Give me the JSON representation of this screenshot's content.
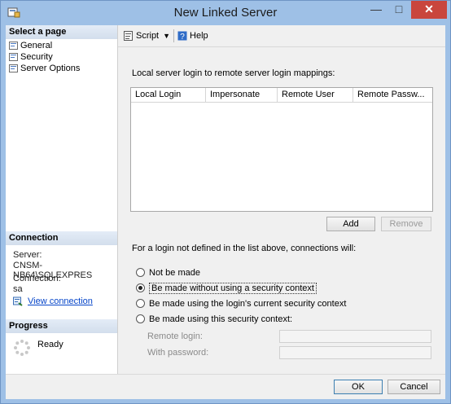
{
  "window": {
    "title": "New Linked Server",
    "minimize_glyph": "—",
    "maximize_glyph": "□",
    "close_glyph": "✕"
  },
  "left_pane": {
    "select_page_header": "Select a page",
    "pages": [
      {
        "label": "General"
      },
      {
        "label": "Security"
      },
      {
        "label": "Server Options"
      }
    ],
    "connection_header": "Connection",
    "server_label": "Server:",
    "server_value": "CNSM-NB64\\SQLEXPRES",
    "connection_label": "Connection:",
    "connection_value": "sa",
    "view_connection_link": "View connection",
    "progress_header": "Progress",
    "progress_status": "Ready"
  },
  "toolbar": {
    "script_label": "Script",
    "help_label": "Help"
  },
  "security": {
    "mappings_label": "Local server login to remote server login mappings:",
    "columns": [
      "Local Login",
      "Impersonate",
      "Remote User",
      "Remote Passw..."
    ],
    "add_button": "Add",
    "remove_button": "Remove",
    "not_defined_label": "For a login not defined in the list above, connections will:",
    "options": [
      {
        "label": "Not be made",
        "checked": false
      },
      {
        "label": "Be made without using a security context",
        "checked": true
      },
      {
        "label": "Be made using the login's current security context",
        "checked": false
      },
      {
        "label": "Be made using this security context:",
        "checked": false
      }
    ],
    "remote_login_label": "Remote login:",
    "remote_login_value": "",
    "password_label": "With password:",
    "password_value": ""
  },
  "footer": {
    "ok_button": "OK",
    "cancel_button": "Cancel"
  }
}
